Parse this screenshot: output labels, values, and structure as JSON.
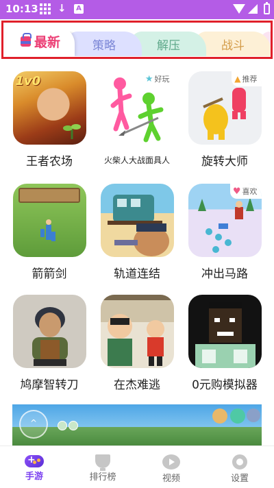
{
  "status_bar": {
    "time": "10:13",
    "icons": [
      "grid-icon",
      "download-icon",
      "a-icon",
      "wifi-icon",
      "signal-icon",
      "battery-icon"
    ]
  },
  "tabs": [
    {
      "label": "最新",
      "selected": true,
      "color": "#ec3f75"
    },
    {
      "label": "策略",
      "selected": false,
      "color": "#7b86d6"
    },
    {
      "label": "解压",
      "selected": false,
      "color": "#5fa98b"
    },
    {
      "label": "战斗",
      "selected": false,
      "color": "#d39b47"
    }
  ],
  "games": [
    {
      "name": "王者农场",
      "badge_text": "1v0"
    },
    {
      "name": "火柴人大战面具人",
      "tag": "好玩",
      "tag_icon": "star-icon"
    },
    {
      "name": "旋转大师",
      "tag": "推荐",
      "tag_icon": "thumbs-up-icon"
    },
    {
      "name": "箭箭剑"
    },
    {
      "name": "轨道连结"
    },
    {
      "name": "冲出马路",
      "tag": "喜欢",
      "tag_icon": "heart-icon"
    },
    {
      "name": "鸠摩智转刀"
    },
    {
      "name": "在杰难逃"
    },
    {
      "name": "0元购模拟器"
    }
  ],
  "bottom_nav": [
    {
      "label": "手游",
      "icon": "gamepad-icon",
      "selected": true
    },
    {
      "label": "排行榜",
      "icon": "trophy-icon",
      "selected": false
    },
    {
      "label": "视频",
      "icon": "video-icon",
      "selected": false
    },
    {
      "label": "设置",
      "icon": "gear-icon",
      "selected": false
    }
  ],
  "colors": {
    "status_bar": "#b45ce6",
    "highlight_border": "#e01f2a",
    "accent": "#7a3ff0"
  }
}
